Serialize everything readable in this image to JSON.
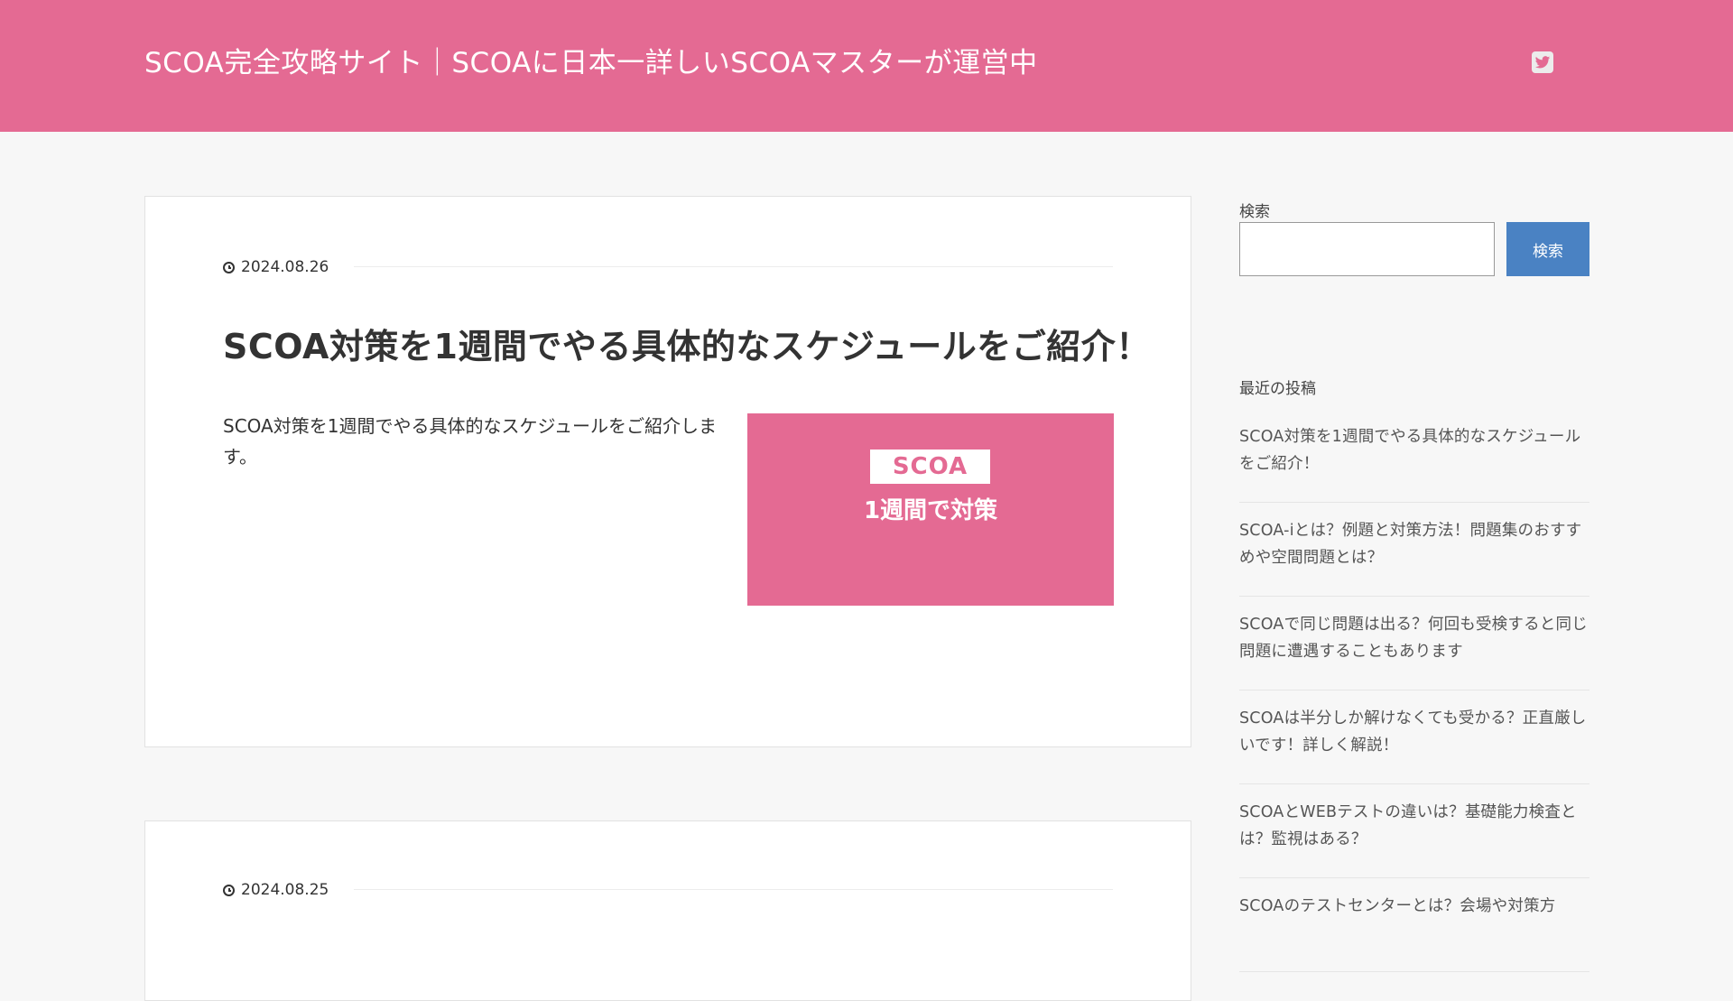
{
  "theme": {
    "brand": "#e46a93",
    "accent": "#4a82c3"
  },
  "header": {
    "site_title": "SCOA完全攻略サイト｜SCOAに日本一詳しいSCOAマスターが運営中",
    "social_icon": "twitter-icon"
  },
  "posts": [
    {
      "date": "2024.08.26",
      "title": "SCOA対策を1週間でやる具体的なスケジュールをご紹介！",
      "excerpt": "SCOA対策を1週間でやる具体的なスケジュールをご紹介します。",
      "thumbnail": {
        "tag": "SCOA",
        "subtitle": "1週間で対策"
      }
    },
    {
      "date": "2024.08.25"
    }
  ],
  "sidebar": {
    "search": {
      "label": "検索",
      "button_label": "検索",
      "value": "",
      "placeholder": ""
    },
    "recent": {
      "heading": "最近の投稿",
      "items": [
        "SCOA対策を1週間でやる具体的なスケジュールをご紹介！",
        "SCOA-iとは？例題と対策方法！問題集のおすすめや空間問題とは？",
        "SCOAで同じ問題は出る？何回も受検すると同じ問題に遭遇することもあります",
        "SCOAは半分しか解けなくても受かる？正直厳しいです！詳しく解説！",
        "SCOAとWEBテストの違いは？基礎能力検査とは？監視はある？",
        "SCOAのテストセンターとは？会場や対策方"
      ]
    }
  }
}
